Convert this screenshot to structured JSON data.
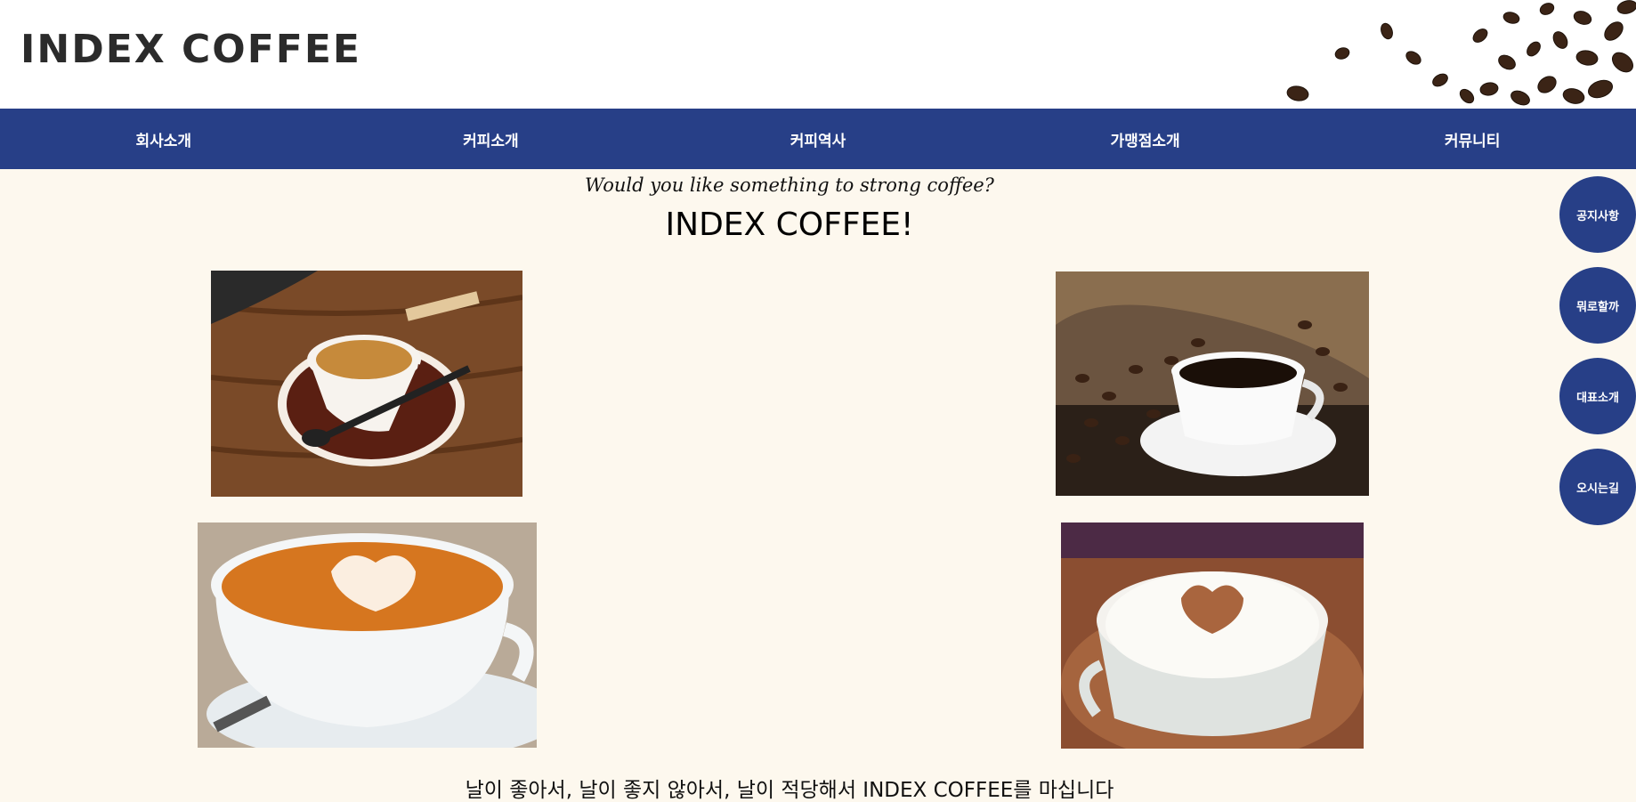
{
  "header": {
    "logo": "INDEX COFFEE"
  },
  "nav": {
    "items": [
      {
        "label": "회사소개"
      },
      {
        "label": "커피소개"
      },
      {
        "label": "커피역사"
      },
      {
        "label": "가맹점소개"
      },
      {
        "label": "커뮤니티"
      }
    ]
  },
  "hero": {
    "tagline": "Would you like something to strong coffee?",
    "headline": "INDEX COFFEE!"
  },
  "side_buttons": [
    {
      "label": "공지사항"
    },
    {
      "label": "뭐로할까"
    },
    {
      "label": "대표소개"
    },
    {
      "label": "오시는길"
    }
  ],
  "footer": {
    "text": "날이 좋아서, 날이 좋지 않아서, 날이 적당해서 INDEX COFFEE를 마십니다"
  },
  "colors": {
    "nav_background": "#273f87",
    "page_background": "#fdf8ee",
    "header_background": "#ffffff"
  }
}
